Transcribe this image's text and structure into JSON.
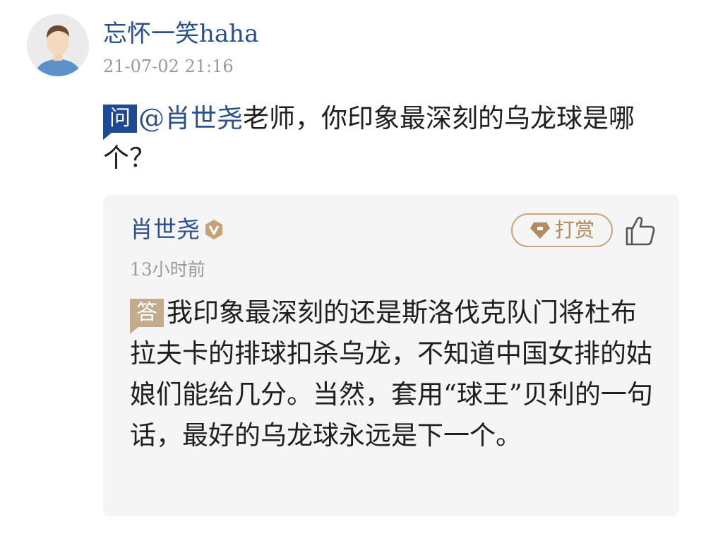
{
  "comment": {
    "username": "忘怀一笑haha",
    "timestamp": "21-07-02 21:16",
    "question_badge": "问",
    "mention": "@肖世尧",
    "question_text": "老师，你印象最深刻的乌龙球是哪个？",
    "avatar_icon": "default-user-avatar"
  },
  "answer": {
    "responder": "肖世尧",
    "verified_icon": "verified-v-badge",
    "reward_label": "打赏",
    "reward_icon": "gem-icon",
    "like_icon": "thumbs-up-icon",
    "time": "13小时前",
    "answer_badge": "答",
    "text": "我印象最深刻的还是斯洛伐克队门将杜布拉夫卡的排球扣杀乌龙，不知道中国女排的姑娘们能给几分。当然，套用“球王”贝利的一句话，最好的乌龙球永远是下一个。"
  },
  "colors": {
    "link_blue": "#2a4f8f",
    "question_badge": "#1f4a93",
    "answer_badge": "#c5ab8e",
    "reward_gold": "#b48a5e",
    "muted_text": "#9a9a9a",
    "card_bg": "#f5f5f5"
  }
}
